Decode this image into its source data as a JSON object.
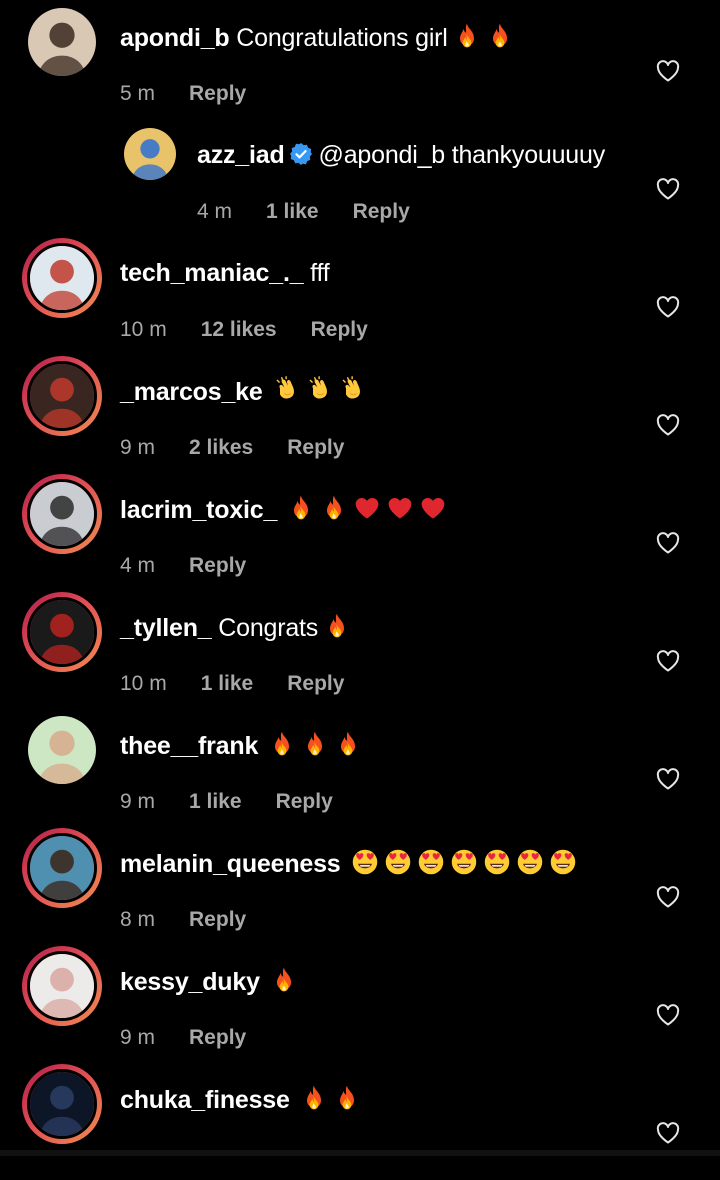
{
  "comments": [
    {
      "username": "apondi_b",
      "text": "Congratulations girl",
      "emojis": [
        "fire",
        "fire"
      ],
      "time": "5 m",
      "likes": "",
      "reply_label": "Reply",
      "story_ring": false,
      "verified": false,
      "is_reply": false,
      "avatar_colors": [
        "#d9c9b4",
        "#3a2a20"
      ]
    },
    {
      "username": "azz_iad",
      "text": "@apondi_b thankyouuuuy",
      "emojis": [],
      "time": "4 m",
      "likes": "1 like",
      "reply_label": "Reply",
      "story_ring": false,
      "verified": true,
      "is_reply": true,
      "avatar_colors": [
        "#e8c36a",
        "#2b6fd6"
      ]
    },
    {
      "username": "tech_maniac_._",
      "text": "fff",
      "emojis": [],
      "time": "10 m",
      "likes": "12 likes",
      "reply_label": "Reply",
      "story_ring": true,
      "verified": false,
      "is_reply": false,
      "avatar_colors": [
        "#dfe8ef",
        "#c0392b"
      ]
    },
    {
      "username": "_marcos_ke",
      "text": "",
      "emojis": [
        "clap",
        "clap",
        "clap"
      ],
      "time": "9 m",
      "likes": "2 likes",
      "reply_label": "Reply",
      "story_ring": true,
      "verified": false,
      "is_reply": false,
      "avatar_colors": [
        "#3a2620",
        "#c0392b"
      ]
    },
    {
      "username": "lacrim_toxic_",
      "text": "",
      "emojis": [
        "fire",
        "fire",
        "heart",
        "heart",
        "heart"
      ],
      "time": "4 m",
      "likes": "",
      "reply_label": "Reply",
      "story_ring": true,
      "verified": false,
      "is_reply": false,
      "avatar_colors": [
        "#c9ccd1",
        "#2a2a2a"
      ]
    },
    {
      "username": "_tyllen_",
      "text": "Congrats",
      "emojis": [
        "fire"
      ],
      "time": "10 m",
      "likes": "1 like",
      "reply_label": "Reply",
      "story_ring": true,
      "verified": false,
      "is_reply": false,
      "avatar_colors": [
        "#1a1a1a",
        "#b8231f"
      ]
    },
    {
      "username": "thee__frank",
      "text": "",
      "emojis": [
        "fire",
        "fire",
        "fire"
      ],
      "time": "9 m",
      "likes": "1 like",
      "reply_label": "Reply",
      "story_ring": false,
      "verified": false,
      "is_reply": false,
      "avatar_colors": [
        "#cde6c4",
        "#d7a98a"
      ]
    },
    {
      "username": "melanin_queeness",
      "text": "",
      "emojis": [
        "heart-eyes",
        "heart-eyes",
        "heart-eyes",
        "heart-eyes",
        "heart-eyes",
        "heart-eyes",
        "heart-eyes"
      ],
      "time": "8 m",
      "likes": "",
      "reply_label": "Reply",
      "story_ring": true,
      "verified": false,
      "is_reply": false,
      "avatar_colors": [
        "#4f8fb0",
        "#3b2418"
      ]
    },
    {
      "username": "kessy_duky",
      "text": "",
      "emojis": [
        "fire"
      ],
      "time": "9 m",
      "likes": "",
      "reply_label": "Reply",
      "story_ring": true,
      "verified": false,
      "is_reply": false,
      "avatar_colors": [
        "#ecebea",
        "#d9a7a0"
      ]
    },
    {
      "username": "chuka_finesse",
      "text": "",
      "emojis": [
        "fire",
        "fire"
      ],
      "time": "",
      "likes": "",
      "reply_label": "",
      "story_ring": true,
      "verified": false,
      "is_reply": false,
      "avatar_colors": [
        "#0d1626",
        "#2c3e66"
      ]
    }
  ],
  "colors": {
    "background": "#000000",
    "text": "#ffffff",
    "meta": "#a8a8a8",
    "verified": "#3897f0",
    "story_ring": "#e04e54"
  }
}
